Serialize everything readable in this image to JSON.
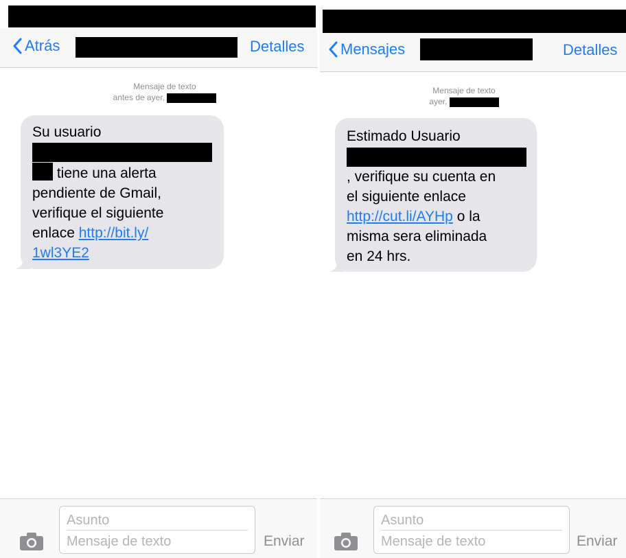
{
  "colors": {
    "ios_blue": "#1f7cf5",
    "bubble_gray": "#e5e5ea",
    "meta_gray": "#8e8e93",
    "redaction": "#000000"
  },
  "left": {
    "nav": {
      "back_label": "Atrás",
      "details_label": "Detalles",
      "back_icon": "chevron-left-icon"
    },
    "meta": {
      "type_label": "Mensaje de texto",
      "date_label": "antes de ayer,"
    },
    "message": {
      "line1": "Su usuario",
      "line3_text": "tiene una alerta",
      "line4": "pendiente de Gmail,",
      "line5": "verifique el siguiente",
      "line6_text": "enlace",
      "link_part1": "http://bit.ly/",
      "link_part2": "1wl3YE2"
    },
    "composer": {
      "camera_icon": "camera-icon",
      "subject_placeholder": "Asunto",
      "message_placeholder": "Mensaje de texto",
      "send_label": "Enviar"
    }
  },
  "right": {
    "nav": {
      "back_label": "Mensajes",
      "details_label": "Detalles",
      "back_icon": "chevron-left-icon"
    },
    "meta": {
      "type_label": "Mensaje de texto",
      "date_label": "ayer,"
    },
    "message": {
      "line1": "Estimado Usuario",
      "line3": ", verifique su cuenta en",
      "line4": "el siguiente enlace",
      "link": "http://cut.li/AYHp",
      "line5_after_link": "o la",
      "line6": "misma sera eliminada",
      "line7": "en 24 hrs."
    },
    "composer": {
      "camera_icon": "camera-icon",
      "subject_placeholder": "Asunto",
      "message_placeholder": "Mensaje de texto",
      "send_label": "Enviar"
    }
  }
}
